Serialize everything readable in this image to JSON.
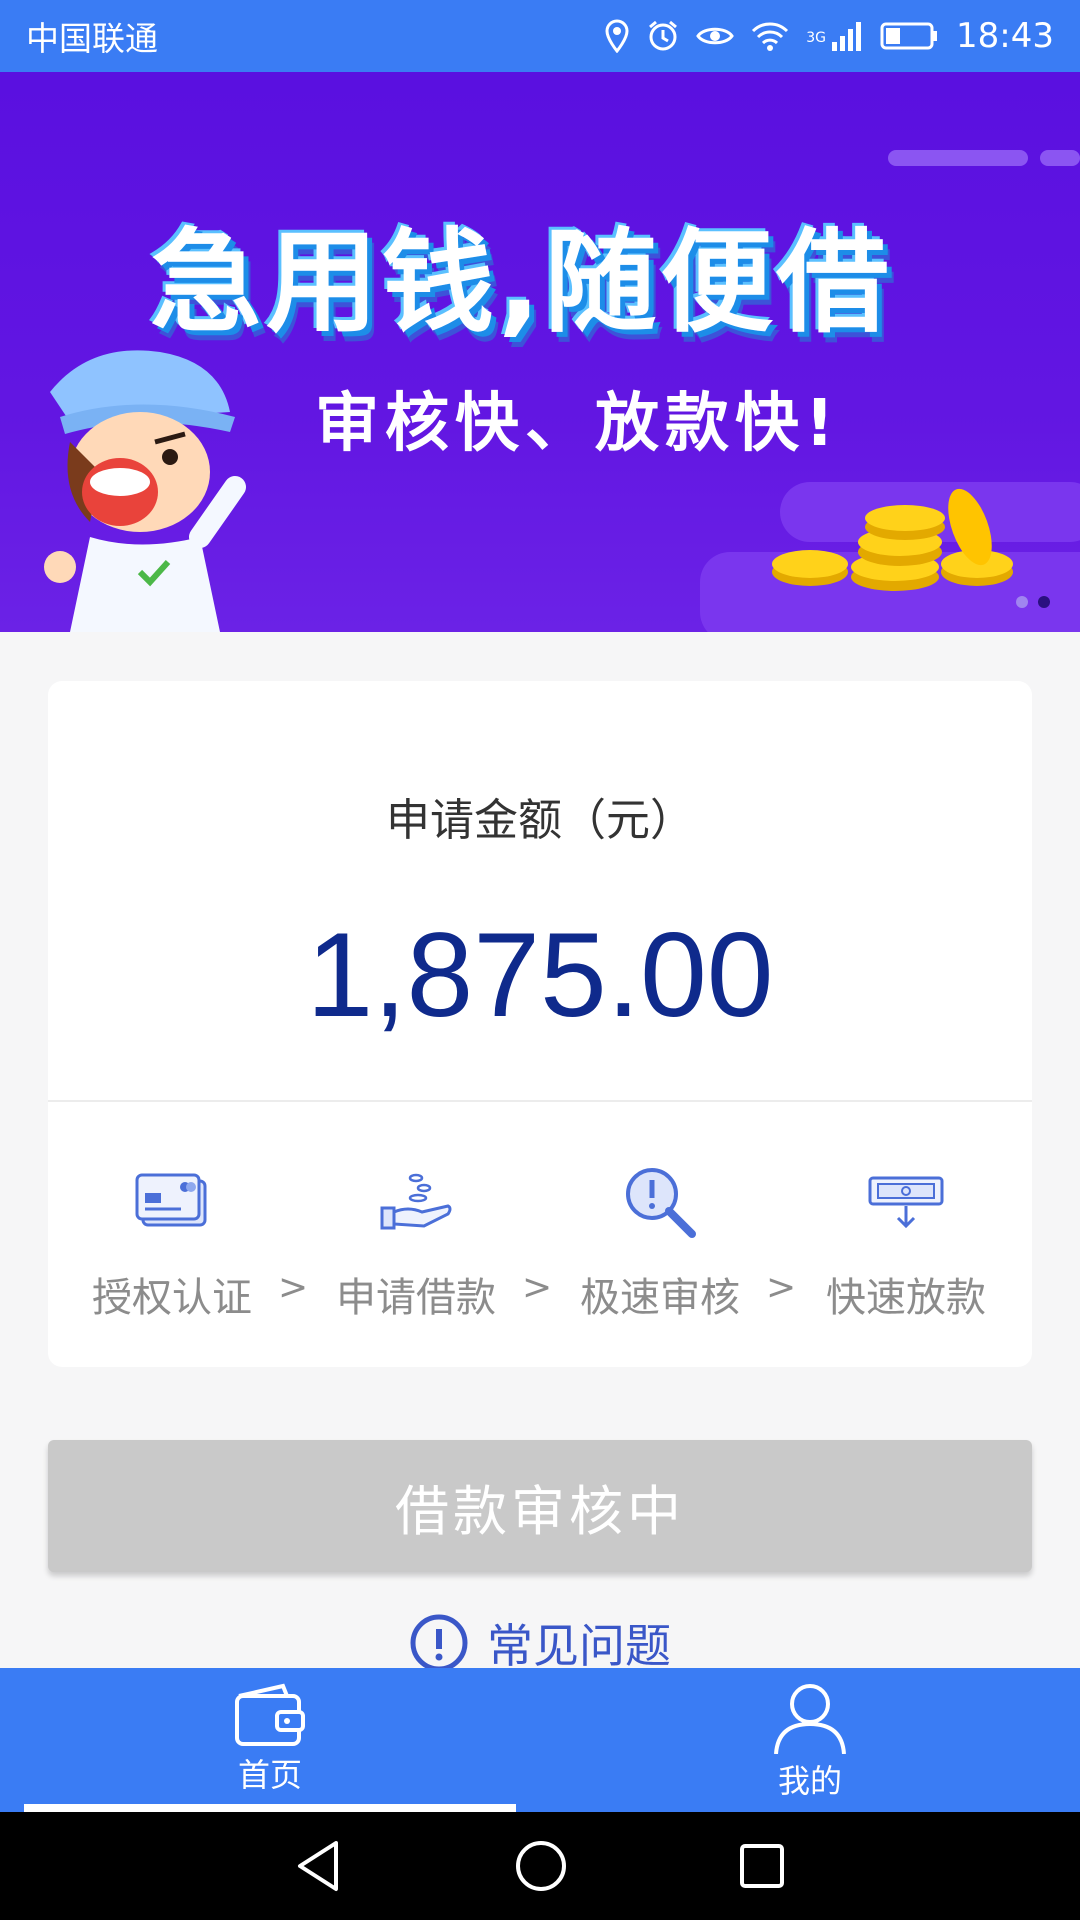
{
  "status_bar": {
    "carrier": "中国联通",
    "network": "3G",
    "time": "18:43"
  },
  "banner": {
    "headline": "急用钱,随便借",
    "subline": "审核快、放款快!",
    "page_count": 2,
    "active_page": 2
  },
  "loan": {
    "amount_label": "申请金额（元）",
    "amount_value": "1,875.00"
  },
  "steps": [
    {
      "label": "授权认证",
      "icon": "id-card-icon"
    },
    {
      "label": "申请借款",
      "icon": "hand-coin-icon"
    },
    {
      "label": "极速审核",
      "icon": "magnifier-alert-icon"
    },
    {
      "label": "快速放款",
      "icon": "cash-out-icon"
    }
  ],
  "step_separator": ">",
  "action": {
    "button_label": "借款审核中"
  },
  "faq": {
    "label": "常见问题"
  },
  "bottom_nav": {
    "items": [
      {
        "label": "首页",
        "icon": "wallet-icon",
        "active": true
      },
      {
        "label": "我的",
        "icon": "user-icon",
        "active": false
      }
    ]
  },
  "colors": {
    "primary": "#3a7cf4",
    "banner_bg": "#5a10e0",
    "amount_text": "#0f2a8c",
    "button_disabled": "#c9c9c9",
    "faq_text": "#3a57c8"
  }
}
